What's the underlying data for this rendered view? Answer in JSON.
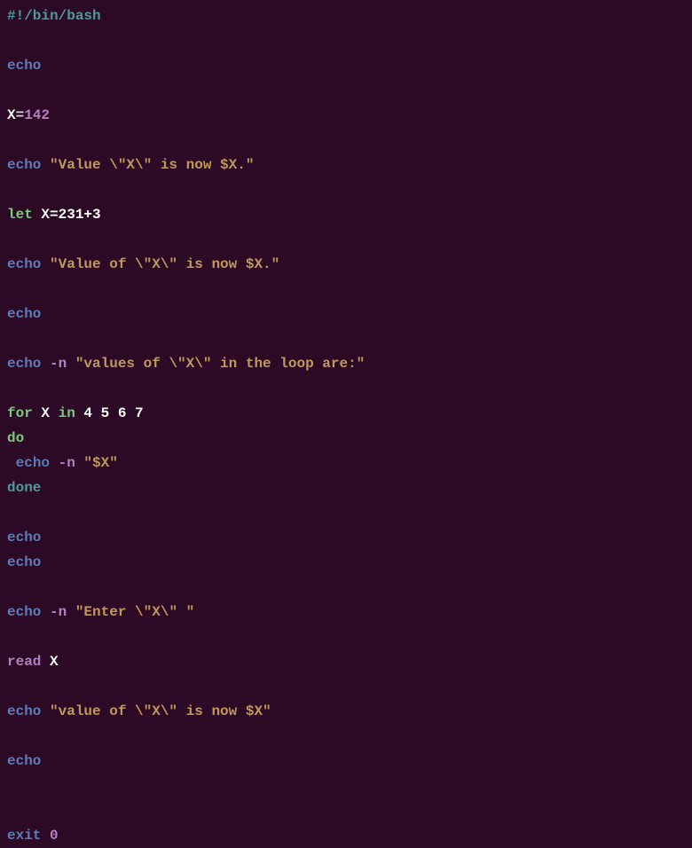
{
  "lines": {
    "l1": {
      "shebang": "#!",
      "path": "/bin/bash"
    },
    "l3": {
      "echo": "echo"
    },
    "l5": {
      "var": "X",
      "eq": "=",
      "val": "142"
    },
    "l7": {
      "echo": "echo",
      "str": " \"Value \\\"X\\\" is now $X.\""
    },
    "l9": {
      "let": "let",
      "expr": " X=231+3"
    },
    "l11": {
      "echo": "echo",
      "str": " \"Value of \\\"X\\\" is now $X.\""
    },
    "l13": {
      "echo": "echo"
    },
    "l15": {
      "echo": "echo",
      "flag": " -n",
      "str": " \"values of \\\"X\\\" in the loop are:\""
    },
    "l17": {
      "for": "for",
      "var": " X ",
      "in": "in",
      "nums": " 4 5 6 7"
    },
    "l18": {
      "do": "do"
    },
    "l19": {
      "indent": " ",
      "echo": "echo",
      "flag": " -n",
      "str": " \"$X\""
    },
    "l20": {
      "done": "done"
    },
    "l22": {
      "echo": "echo"
    },
    "l23": {
      "echo": "echo"
    },
    "l25": {
      "echo": "echo",
      "flag": " -n",
      "str": " \"Enter \\\"X\\\" \""
    },
    "l27": {
      "read": "read",
      "var": " X"
    },
    "l29": {
      "echo": "echo",
      "str": " \"value of \\\"X\\\" is now $X\""
    },
    "l31": {
      "echo": "echo"
    },
    "l34": {
      "exit": "exit",
      "code": " 0"
    }
  }
}
